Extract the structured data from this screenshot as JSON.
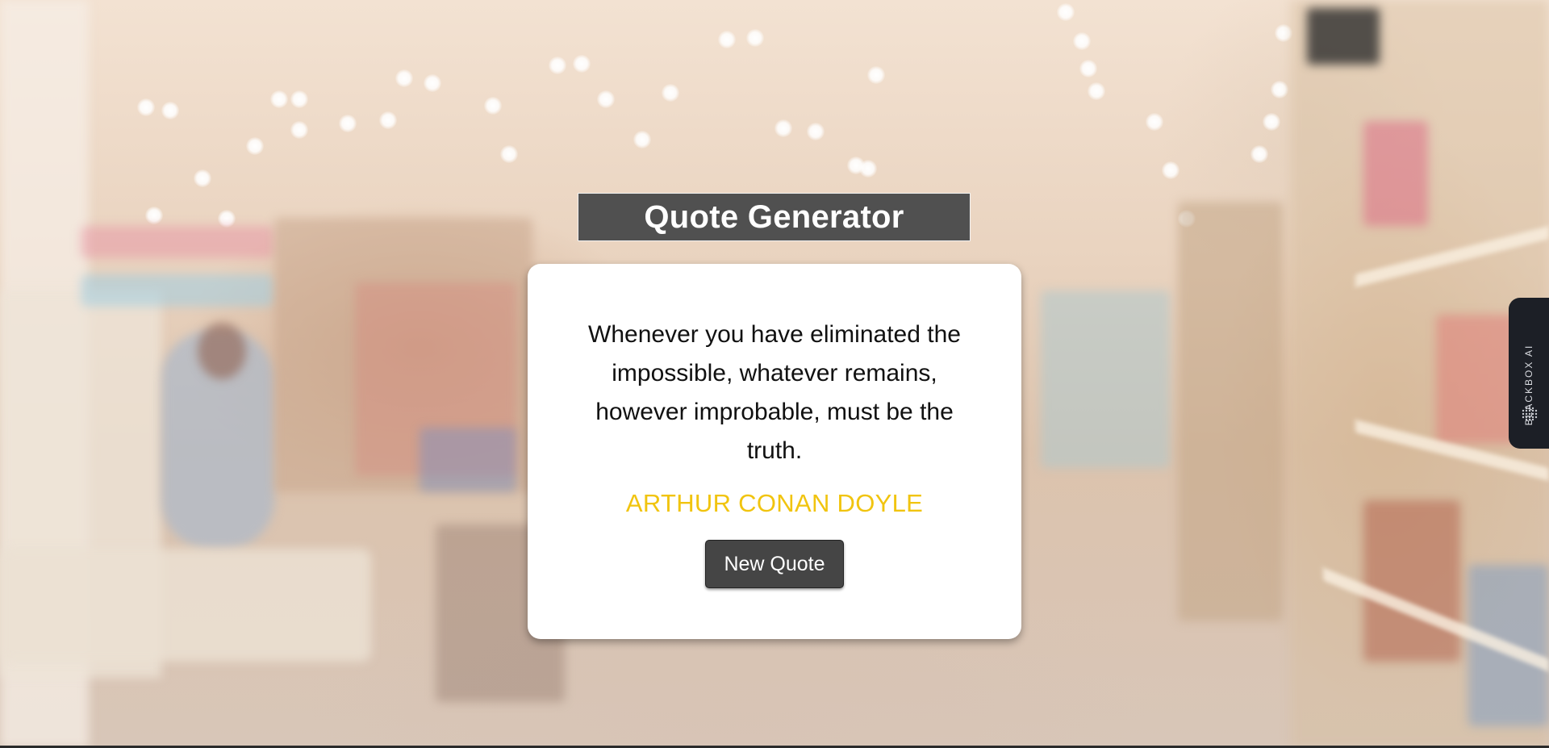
{
  "header": {
    "title": "Quote Generator"
  },
  "quote_card": {
    "quote_text": "Whenever you have eliminated the impossible, whatever remains, however improbable, must be the truth.",
    "author": "ARTHUR CONAN DOYLE",
    "new_quote_label": "New Quote"
  },
  "side_tab": {
    "label": "BLACKBOX AI",
    "icon": "blackbox-logo-icon"
  },
  "colors": {
    "title_bg": "#505050",
    "author": "#f1c40f",
    "button_bg": "#454545",
    "card_bg": "#ffffff"
  }
}
